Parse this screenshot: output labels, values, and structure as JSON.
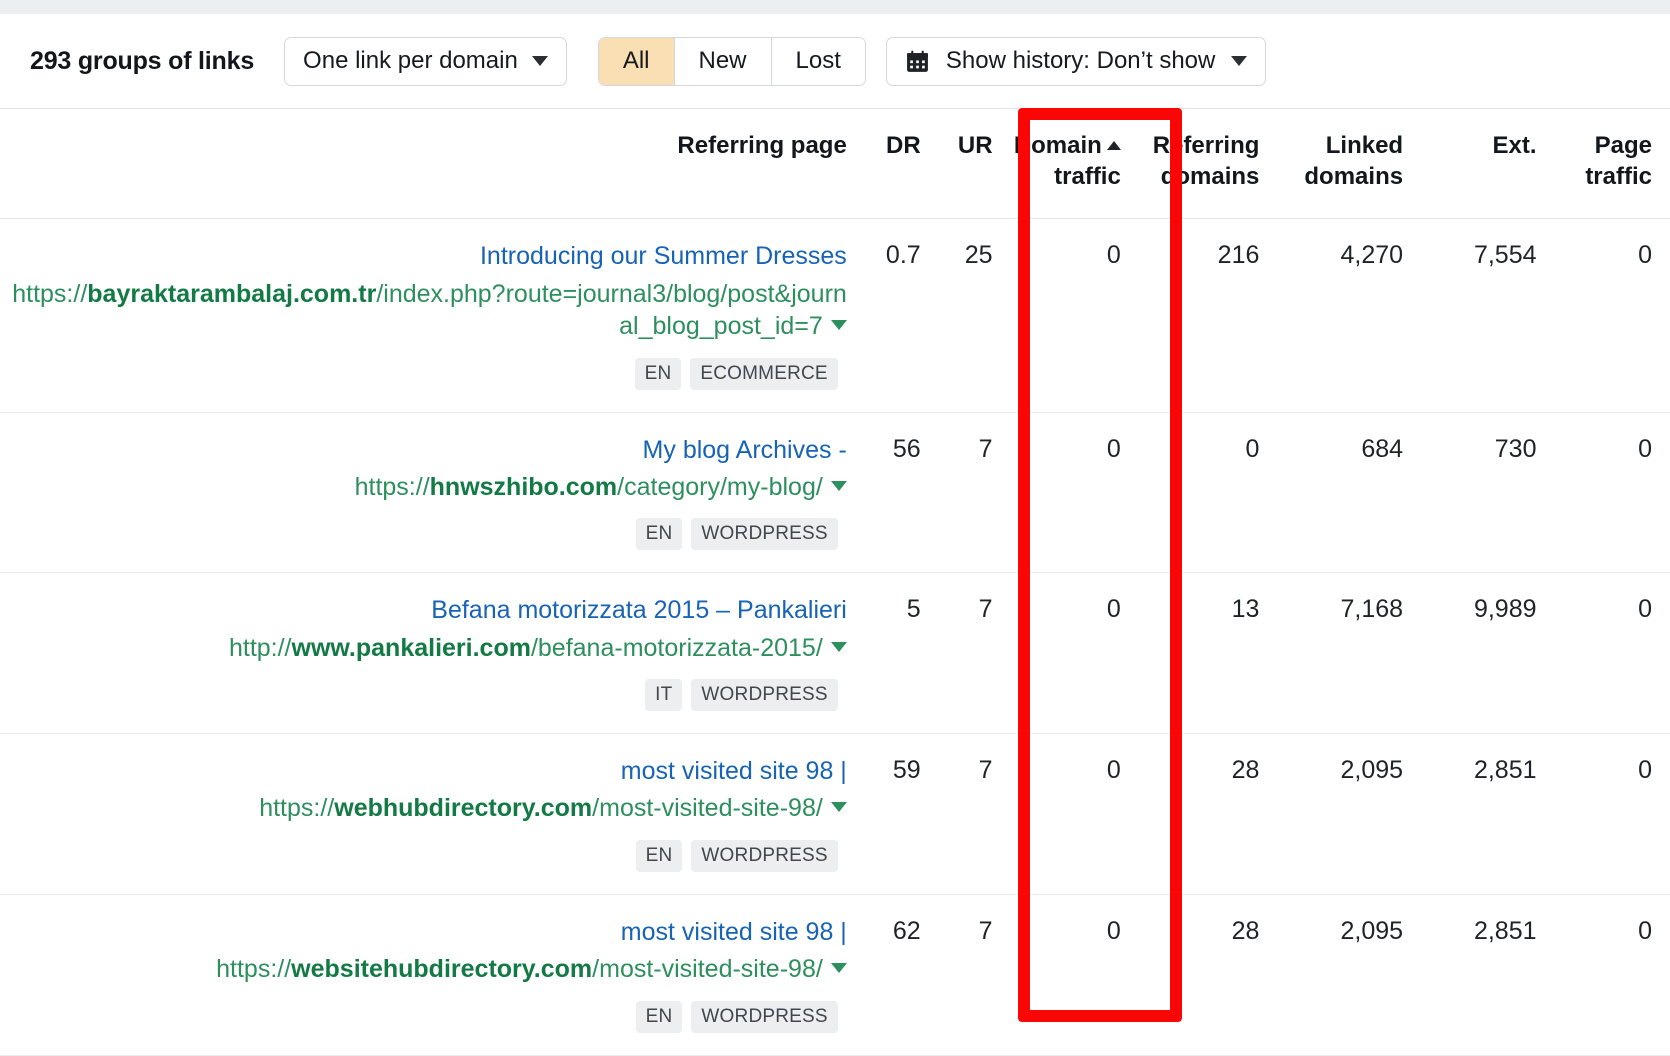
{
  "toolbar": {
    "groups_count_label": "293 groups of links",
    "grouping_dropdown": "One link per domain",
    "segments": [
      {
        "label": "All",
        "active": true
      },
      {
        "label": "New",
        "active": false
      },
      {
        "label": "Lost",
        "active": false
      }
    ],
    "history_label": "Show history: Don’t show",
    "calendar_icon": "calendar-icon",
    "caret_icon": "chevron-down-icon"
  },
  "table": {
    "columns": [
      {
        "key": "page",
        "label": "Referring page",
        "sorted": false
      },
      {
        "key": "dr",
        "label": "DR",
        "sorted": false
      },
      {
        "key": "ur",
        "label": "UR",
        "sorted": false
      },
      {
        "key": "domain_traffic",
        "label_line1": "Domain",
        "label_line2": "traffic",
        "sorted": true,
        "sort_dir": "asc"
      },
      {
        "key": "referring_domains",
        "label_line1": "Referring",
        "label_line2": "domains",
        "sorted": false
      },
      {
        "key": "linked_domains",
        "label_line1": "Linked",
        "label_line2": "domains",
        "sorted": false
      },
      {
        "key": "ext",
        "label": "Ext.",
        "sorted": false
      },
      {
        "key": "page_traffic",
        "label_line1": "Page",
        "label_line2": "traffic",
        "sorted": false
      }
    ],
    "rows": [
      {
        "title": "Introducing our Summer Dresses",
        "url_scheme": "https://",
        "url_domain": "bayraktarambalaj.com.tr",
        "url_path": "/index.php?route=journal3/blog/post&journal_blog_post_id=7",
        "tags": [
          "EN",
          "ECOMMERCE"
        ],
        "dr": "0.7",
        "ur": "25",
        "domain_traffic": "0",
        "referring_domains": "216",
        "linked_domains": "4,270",
        "ext": "7,554",
        "page_traffic": "0"
      },
      {
        "title": "My blog Archives -",
        "url_scheme": "https://",
        "url_domain": "hnwszhibo.com",
        "url_path": "/category/my-blog/",
        "tags": [
          "EN",
          "WORDPRESS"
        ],
        "dr": "56",
        "ur": "7",
        "domain_traffic": "0",
        "referring_domains": "0",
        "linked_domains": "684",
        "ext": "730",
        "page_traffic": "0"
      },
      {
        "title": "Befana motorizzata 2015 – Pankalieri",
        "url_scheme": "http://",
        "url_domain": "www.pankalieri.com",
        "url_path": "/befana-motorizzata-2015/",
        "tags": [
          "IT",
          "WORDPRESS"
        ],
        "dr": "5",
        "ur": "7",
        "domain_traffic": "0",
        "referring_domains": "13",
        "linked_domains": "7,168",
        "ext": "9,989",
        "page_traffic": "0"
      },
      {
        "title": "most visited site 98 |",
        "url_scheme": "https://",
        "url_domain": "webhubdirectory.com",
        "url_path": "/most-visited-site-98/",
        "tags": [
          "EN",
          "WORDPRESS"
        ],
        "dr": "59",
        "ur": "7",
        "domain_traffic": "0",
        "referring_domains": "28",
        "linked_domains": "2,095",
        "ext": "2,851",
        "page_traffic": "0"
      },
      {
        "title": "most visited site 98 |",
        "url_scheme": "https://",
        "url_domain": "websitehubdirectory.com",
        "url_path": "/most-visited-site-98/",
        "tags": [
          "EN",
          "WORDPRESS"
        ],
        "dr": "62",
        "ur": "7",
        "domain_traffic": "0",
        "referring_domains": "28",
        "linked_domains": "2,095",
        "ext": "2,851",
        "page_traffic": "0"
      }
    ]
  },
  "annotation": {
    "shape": "rectangle-highlight",
    "color": "#fb0606",
    "target_column": "Domain traffic"
  }
}
